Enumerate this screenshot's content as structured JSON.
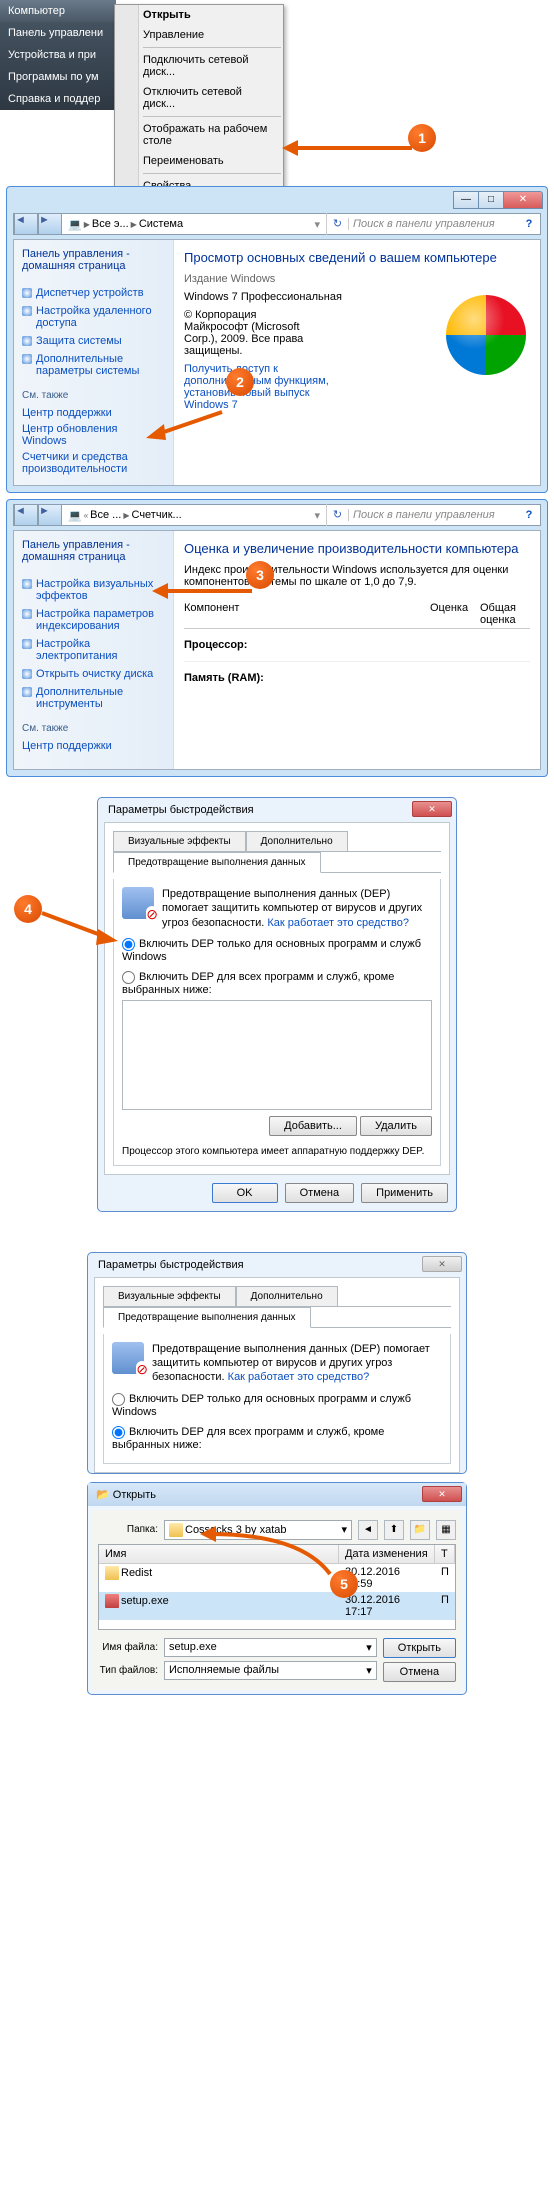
{
  "s1": {
    "sm": [
      "Компьютер",
      "Панель управлени",
      "Устройства и при",
      "Программы по ум",
      "Справка и поддер"
    ],
    "ctx": [
      "Открыть",
      "Управление",
      "Подключить сетевой диск...",
      "Отключить сетевой диск...",
      "Отображать на рабочем столе",
      "Переименовать",
      "Свойства"
    ]
  },
  "s2": {
    "crumb": [
      "Все э...",
      "Система"
    ],
    "search": "Поиск в панели управления",
    "help": "?",
    "sb_title": "Панель управления - домашняя страница",
    "sb_links": [
      "Диспетчер устройств",
      "Настройка удаленного доступа",
      "Защита системы",
      "Дополнительные параметры системы"
    ],
    "sb_see": "См. также",
    "sb_plain": [
      "Центр поддержки",
      "Центр обновления Windows",
      "Счетчики и средства производительности"
    ],
    "mp_title": "Просмотр основных сведений о вашем компьютере",
    "mp_ed": "Издание Windows",
    "mp_win": "Windows 7 Профессиональная",
    "mp_copy": "© Корпорация Майкрософт (Microsoft Corp.), 2009. Все права защищены.",
    "mp_link": "Получить доступ к дополнительным функциям, установив новый выпуск Windows 7"
  },
  "s3": {
    "crumb": [
      "Все ...",
      "Счетчик..."
    ],
    "search": "Поиск в панели управления",
    "sb_title": "Панель управления - домашняя страница",
    "sb_links": [
      "Настройка визуальных эффектов",
      "Настройка параметров индексирования",
      "Настройка электропитания",
      "Открыть очистку диска",
      "Дополнительные инструменты"
    ],
    "sb_see": "См. также",
    "sb_plain": [
      "Центр поддержки"
    ],
    "mp_title": "Оценка и увеличение производительности компьютера",
    "mp_text": "Индекс производительности Windows используется для оценки компонентов системы по шкале от 1,0 до 7,9.",
    "col_k": "Компонент",
    "col_o": "Оценка",
    "col_ob": "Общая оценка",
    "row_cpu": "Процессор:",
    "row_ram": "Память (RAM):"
  },
  "s4": {
    "title": "Параметры быстродействия",
    "tabs": [
      "Визуальные эффекты",
      "Дополнительно"
    ],
    "gb": "Предотвращение выполнения данных",
    "desc": "Предотвращение выполнения данных (DEP) помогает защитить компьютер от вирусов и других угроз безопасности. ",
    "desc_link": "Как работает это средство?",
    "r1": "Включить DEP только для основных программ и служб Windows",
    "r2": "Включить DEP для всех программ и служб, кроме выбранных ниже:",
    "add": "Добавить...",
    "del": "Удалить",
    "note": "Процессор этого компьютера имеет аппаратную поддержку DEP.",
    "ok": "OK",
    "cancel": "Отмена",
    "apply": "Применить"
  },
  "s5": {
    "title": "Параметры быстродействия",
    "tabs": [
      "Визуальные эффекты",
      "Дополнительно"
    ],
    "gb": "Предотвращение выполнения данных",
    "desc": "Предотвращение выполнения данных (DEP) помогает защитить компьютер от вирусов и других угроз безопасности. ",
    "desc_link": "Как работает это средство?",
    "r1": "Включить DEP только для основных программ и служб Windows",
    "r2": "Включить DEP для всех программ и служб, кроме выбранных ниже:",
    "od": {
      "title": "Открыть",
      "folder_lbl": "Папка:",
      "folder": "Cossacks 3 by xatab",
      "cols": [
        "Имя",
        "Дата изменения",
        "Т"
      ],
      "rows": [
        {
          "n": "Redist",
          "d": "30.12.2016 16:59",
          "t": "П",
          "ico": "folder"
        },
        {
          "n": "setup.exe",
          "d": "30.12.2016 17:17",
          "t": "П",
          "ico": "exe"
        }
      ],
      "fn_lbl": "Имя файла:",
      "fn": "setup.exe",
      "ft_lbl": "Тип файлов:",
      "ft": "Исполняемые файлы",
      "open": "Открыть",
      "cancel": "Отмена"
    }
  },
  "badges": [
    "1",
    "2",
    "3",
    "4",
    "5"
  ]
}
